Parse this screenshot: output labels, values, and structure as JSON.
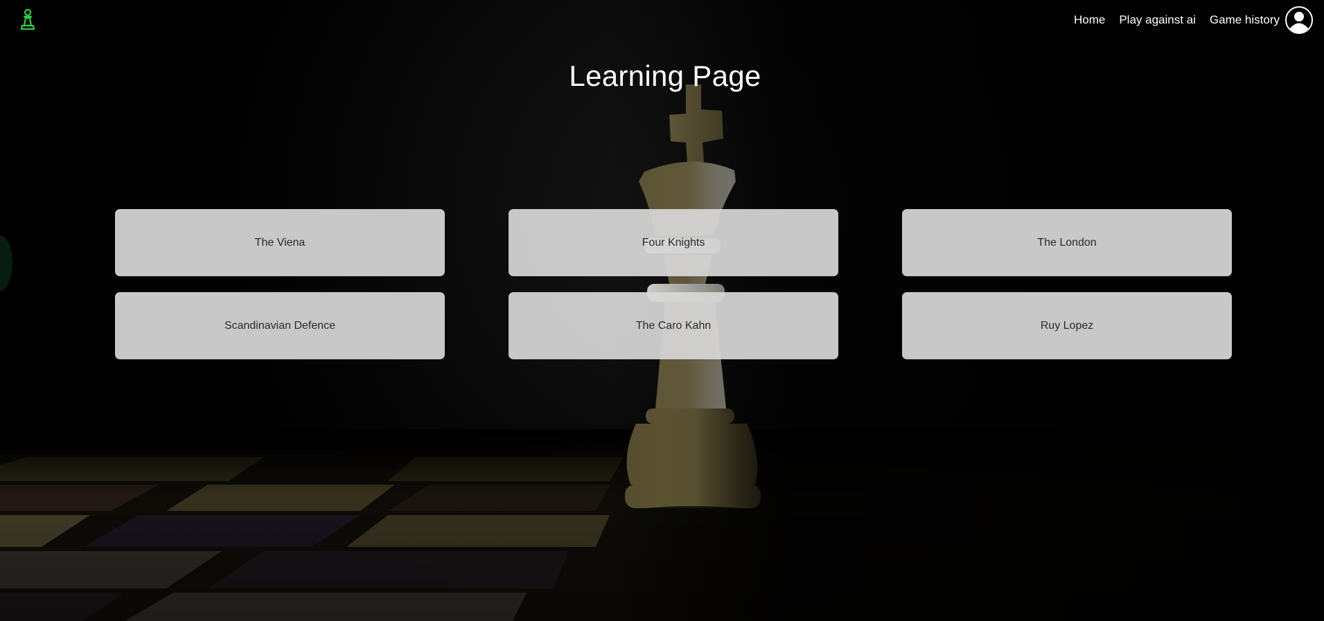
{
  "brand": {
    "logo_icon": "chess-pawn-icon",
    "accent_color": "#2ecc40"
  },
  "nav": {
    "home_label": "Home",
    "play_ai_label": "Play against ai",
    "history_label": "Game history",
    "avatar_icon": "user-avatar-icon"
  },
  "page": {
    "title": "Learning Page"
  },
  "openings": [
    {
      "label": "The Viena"
    },
    {
      "label": "Four Knights"
    },
    {
      "label": "The London"
    },
    {
      "label": "Scandinavian Defence"
    },
    {
      "label": "The Caro Kahn"
    },
    {
      "label": "Ruy Lopez"
    }
  ],
  "background": {
    "image_icon": "chess-king-on-board-image"
  }
}
